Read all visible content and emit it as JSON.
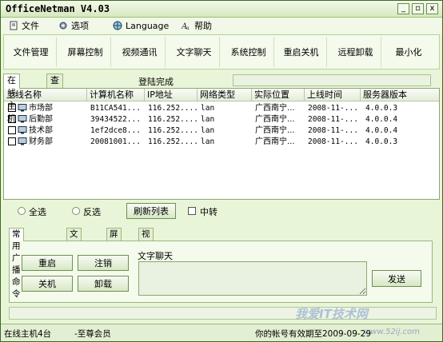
{
  "app": {
    "title": "OfficeNetman V4.03",
    "window_buttons": [
      "_",
      "▫",
      "x"
    ]
  },
  "menu": [
    {
      "label": "文件",
      "icon": "file-icon"
    },
    {
      "label": "选项",
      "icon": "gear-icon"
    },
    {
      "label": "Language",
      "icon": "globe-icon"
    },
    {
      "label": "帮助",
      "icon": "help-icon"
    }
  ],
  "toolbar": {
    "buttons": [
      "文件管理",
      "屏幕控制",
      "视频通讯",
      "文字聊天",
      "系统控制",
      "重启关机",
      "远程卸载",
      "最小化"
    ]
  },
  "tabs": {
    "items": [
      "在线主机",
      "查看公告"
    ],
    "status": "登陆完成"
  },
  "list": {
    "columns": [
      "上线名称",
      "计算机名称",
      "IP地址",
      "网络类型",
      "实际位置",
      "上线时间",
      "服务器版本"
    ],
    "rows": [
      {
        "name": "市场部",
        "computer": "B11CA541...",
        "ip": "116.252....",
        "net": "lan",
        "location": "广西南宁...",
        "time": "2008-11-...",
        "version": "4.0.0.3"
      },
      {
        "name": "后勤部",
        "computer": "39434522...",
        "ip": "116.252....",
        "net": "lan",
        "location": "广西南宁...",
        "time": "2008-11-...",
        "version": "4.0.0.4"
      },
      {
        "name": "技术部",
        "computer": "1ef2dce8...",
        "ip": "116.252....",
        "net": "lan",
        "location": "广西南宁...",
        "time": "2008-11-...",
        "version": "4.0.0.4"
      },
      {
        "name": "财务部",
        "computer": "20081001...",
        "ip": "116.252....",
        "net": "lan",
        "location": "广西南宁...",
        "time": "2008-11-...",
        "version": "4.0.0.3"
      }
    ]
  },
  "controls": {
    "select_all": "全选",
    "invert": "反选",
    "refresh": "刷新列表",
    "relay": "中转"
  },
  "bottom_tabs": [
    "常用广播命令",
    "文件分发",
    "屏幕墙",
    "视频墙"
  ],
  "commands": {
    "restart": "重启",
    "logout": "注销",
    "shutdown": "关机",
    "uninstall": "卸载",
    "chat_label": "文字聊天",
    "send": "发送"
  },
  "statusbar": {
    "online": "在线主机4台",
    "member": "-至尊会员",
    "account": "你的帐号有效期至2009-09-29"
  },
  "watermark": {
    "text": "我爱IT技术网",
    "url": "www.52ij.com"
  }
}
